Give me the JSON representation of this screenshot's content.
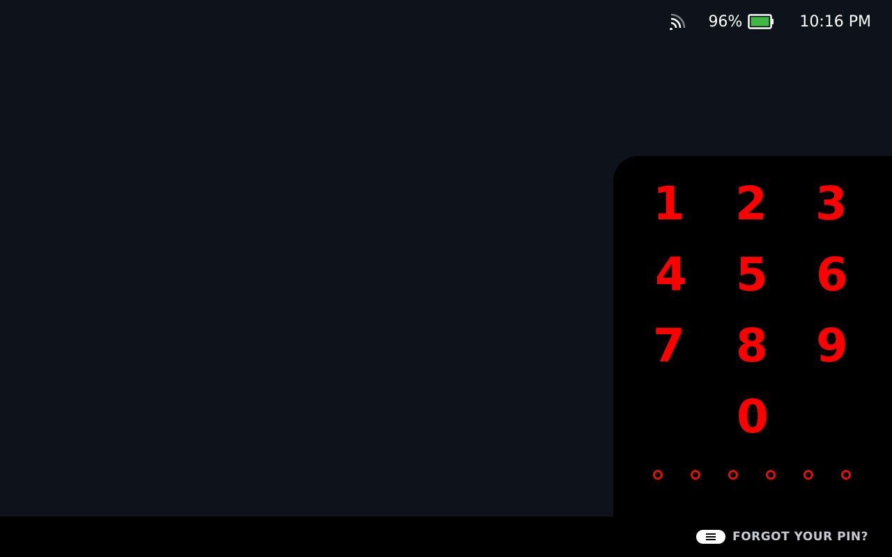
{
  "status_bar": {
    "signal_icon": "wifi-signal-icon",
    "battery_percent": "96%",
    "battery_level": 0.96,
    "battery_color": "#3fb93f",
    "battery_icon": "battery-icon",
    "time": "10:16 PM"
  },
  "keypad": {
    "digit_color": "#ff0000",
    "keys": [
      "1",
      "2",
      "3",
      "4",
      "5",
      "6",
      "7",
      "8",
      "9",
      "0"
    ],
    "pin_length": 6,
    "pin_entered": 0,
    "dot_color": "#e01010"
  },
  "footer": {
    "menu_icon": "menu-button-icon",
    "forgot_label": "FORGOT YOUR PIN?"
  },
  "colors": {
    "background": "#0e131b",
    "panel": "#000000"
  }
}
